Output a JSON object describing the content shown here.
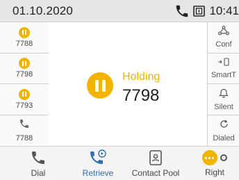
{
  "status_bar": {
    "date": "01.10.2020",
    "time": "10:41",
    "icons": [
      "phone-icon",
      "dnd-icon"
    ]
  },
  "lines": [
    {
      "number": "7788",
      "state": "hold",
      "icon": "hold-icon"
    },
    {
      "number": "7798",
      "state": "hold",
      "icon": "hold-icon"
    },
    {
      "number": "7793",
      "state": "hold",
      "icon": "hold-icon"
    },
    {
      "number": "7788",
      "state": "idle",
      "icon": "phone-icon"
    }
  ],
  "right_keys": [
    {
      "label": "Conf",
      "icon": "conference-icon"
    },
    {
      "label": "SmartT",
      "icon": "smart-transfer-icon"
    },
    {
      "label": "Silent",
      "icon": "bell-icon"
    },
    {
      "label": "Dialed",
      "icon": "redial-icon"
    }
  ],
  "call": {
    "status": "Holding",
    "number": "7798"
  },
  "bottom_keys": [
    {
      "label": "Dial",
      "icon": "phone-icon"
    },
    {
      "label": "Retrieve",
      "icon": "retrieve-icon",
      "active": true
    },
    {
      "label": "Contact Pool",
      "icon": "contacts-icon"
    },
    {
      "label": "Right",
      "icon": "more-icon"
    }
  ],
  "colors": {
    "hold": "#f2b400",
    "accent_blue": "#2f6fb3",
    "status_bar_bg": "#e6e6e6"
  }
}
